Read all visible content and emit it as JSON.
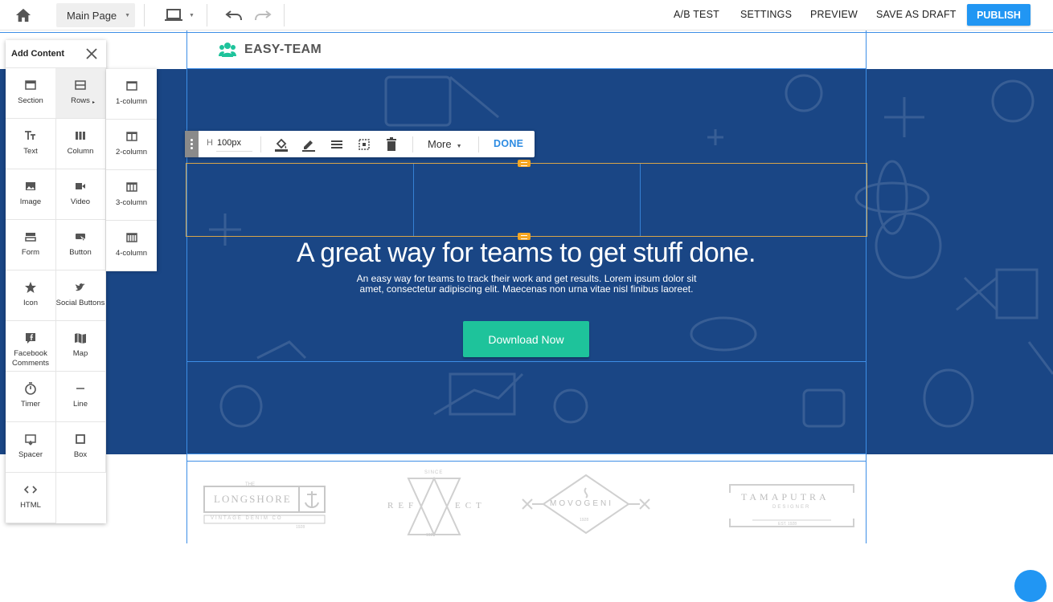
{
  "topbar": {
    "page_select": "Main Page",
    "links": {
      "ab_test": "A/B TEST",
      "settings": "SETTINGS",
      "preview": "PREVIEW",
      "save_draft": "SAVE AS DRAFT"
    },
    "publish": "PUBLISH",
    "icons": [
      "home-icon",
      "laptop-icon",
      "undo-icon",
      "redo-icon"
    ]
  },
  "site": {
    "logo_text": "EASY-TEAM",
    "hero": {
      "title": "A great way for teams to get stuff done.",
      "subtitle_line1": "An easy way for teams to track their work and get results. Lorem ipsum dolor sit",
      "subtitle_line2": "amet, consectetur adipiscing elit. Maecenas non urna vitae nisl finibus laoreet.",
      "cta": "Download Now"
    },
    "client_logos": {
      "longshore": {
        "small": "THE",
        "main": "LONGSHORE",
        "sub": "VINTAGE DENIM CO",
        "year": "1928"
      },
      "reflect": {
        "small": "SINCE",
        "main_left": "REF",
        "main_right": "ECT",
        "year": "1928"
      },
      "movogeni": {
        "main": "MOVOGENI",
        "year": "1928"
      },
      "tamaputra": {
        "main": "TAMAPUTRA",
        "sub": "DESIGNER",
        "year": "EST. 1928"
      }
    }
  },
  "row_toolbar": {
    "height_label": "H",
    "height_value": "100px",
    "more": "More",
    "done": "DONE"
  },
  "add_content": {
    "title": "Add Content",
    "items": [
      {
        "label": "Section",
        "icon": "section-icon"
      },
      {
        "label": "Rows",
        "icon": "rows-icon"
      },
      {
        "label": "Text",
        "icon": "text-icon"
      },
      {
        "label": "Column",
        "icon": "column-icon"
      },
      {
        "label": "Image",
        "icon": "image-icon"
      },
      {
        "label": "Video",
        "icon": "video-icon"
      },
      {
        "label": "Form",
        "icon": "form-icon"
      },
      {
        "label": "Button",
        "icon": "button-icon"
      },
      {
        "label": "Icon",
        "icon": "star-icon"
      },
      {
        "label": "Social Buttons",
        "icon": "twitter-icon"
      },
      {
        "label": "Facebook Comments",
        "icon": "facebook-comment-icon"
      },
      {
        "label": "Map",
        "icon": "map-icon"
      },
      {
        "label": "Timer",
        "icon": "timer-icon"
      },
      {
        "label": "Line",
        "icon": "line-icon"
      },
      {
        "label": "Spacer",
        "icon": "spacer-icon"
      },
      {
        "label": "Box",
        "icon": "box-icon"
      },
      {
        "label": "HTML",
        "icon": "code-icon"
      }
    ],
    "rows_submenu": [
      {
        "label": "1-column",
        "icon": "one-column-icon"
      },
      {
        "label": "2-column",
        "icon": "two-column-icon"
      },
      {
        "label": "3-column",
        "icon": "three-column-icon"
      },
      {
        "label": "4-column",
        "icon": "four-column-icon"
      }
    ]
  },
  "colors": {
    "hero_bg": "#1a4685",
    "cta": "#1ec39b",
    "publish": "#2196f3",
    "guide": "#3d8ee6",
    "handle": "#f5a623",
    "logo_icon": "#1ec39b"
  }
}
